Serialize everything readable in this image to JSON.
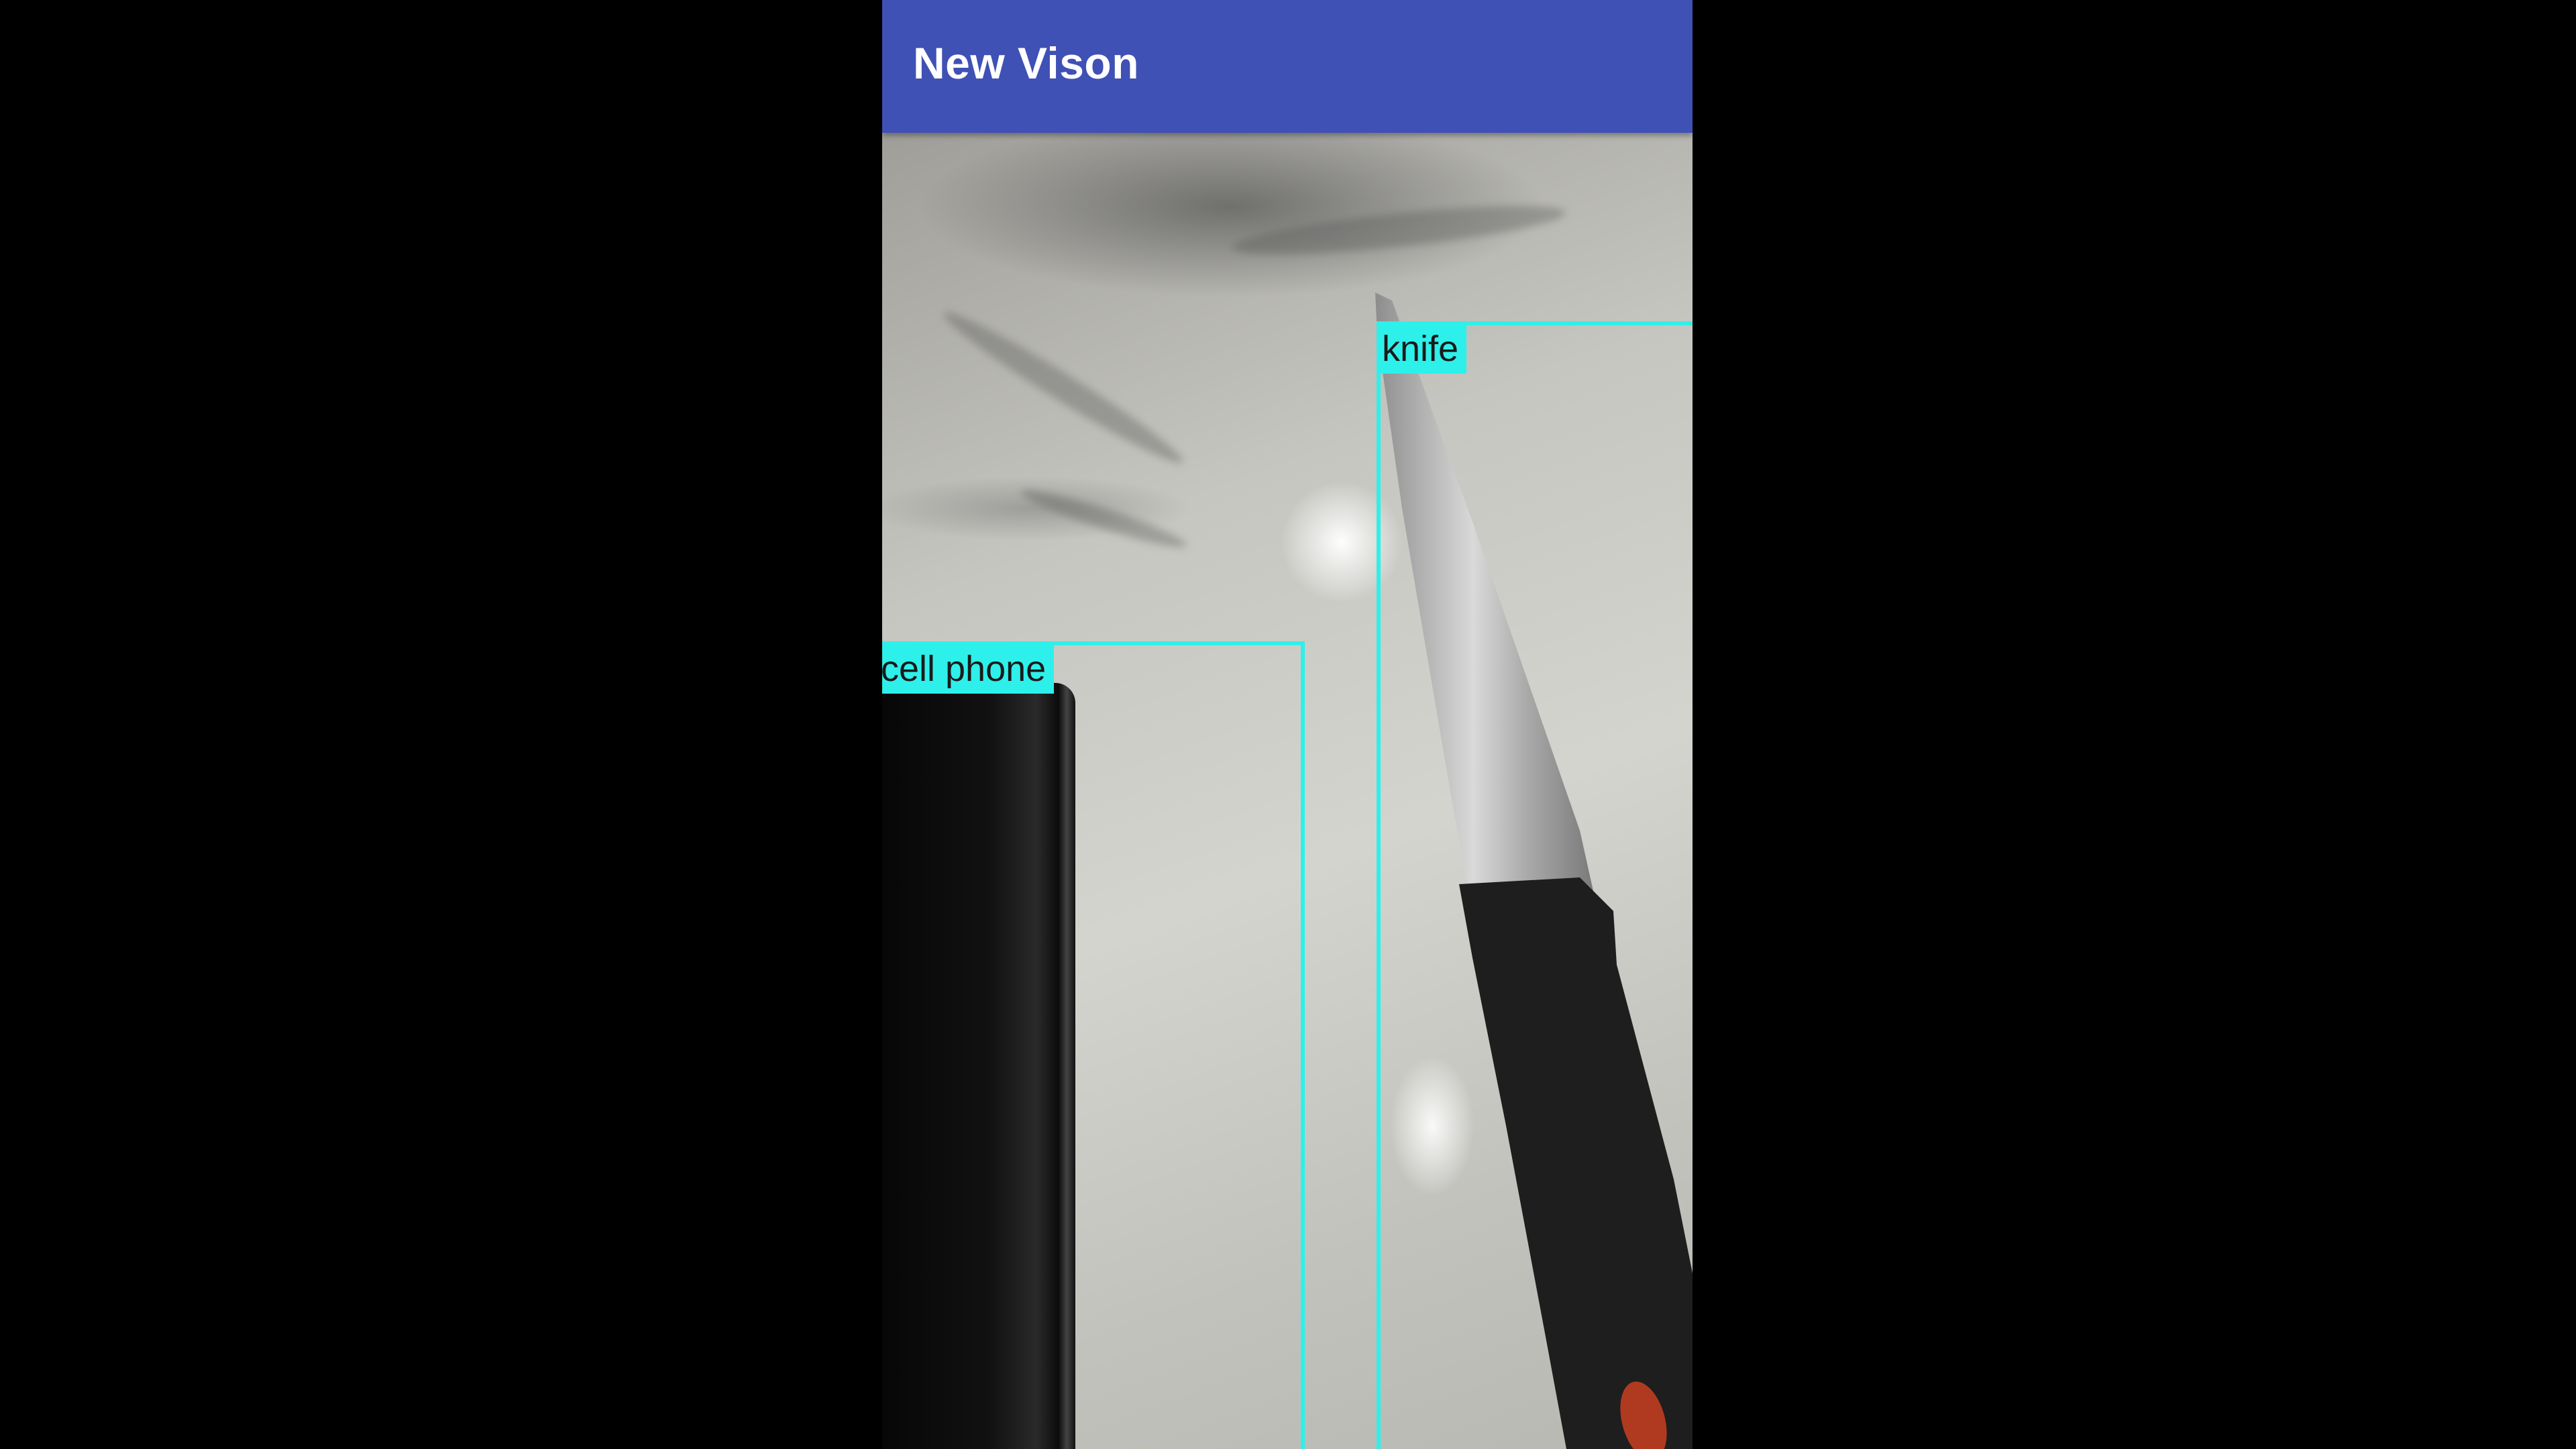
{
  "app_bar": {
    "title": "New Vison",
    "color": "#3f51b5"
  },
  "detections": [
    {
      "label": "cell phone",
      "color": "#2ef0ea"
    },
    {
      "label": "knife",
      "color": "#2ef0ea"
    }
  ]
}
